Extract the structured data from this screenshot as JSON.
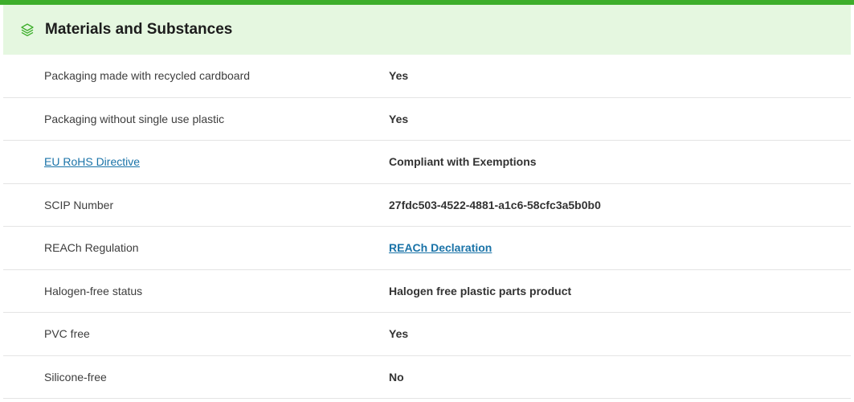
{
  "section": {
    "title": "Materials and Substances",
    "icon": "layers-icon",
    "accent_color": "#3dae2b",
    "header_bg": "#e5f7e0"
  },
  "rows": [
    {
      "label": "Packaging made with recycled cardboard",
      "value": "Yes"
    },
    {
      "label": "Packaging without single use plastic",
      "value": "Yes"
    },
    {
      "label": "EU RoHS Directive",
      "value": "Compliant with Exemptions"
    },
    {
      "label": "SCIP Number",
      "value": "27fdc503-4522-4881-a1c6-58cfc3a5b0b0"
    },
    {
      "label": "REACh Regulation",
      "value": "REACh Declaration"
    },
    {
      "label": "Halogen-free status",
      "value": "Halogen free plastic parts product"
    },
    {
      "label": "PVC free",
      "value": "Yes"
    },
    {
      "label": "Silicone-free",
      "value": "No"
    }
  ]
}
